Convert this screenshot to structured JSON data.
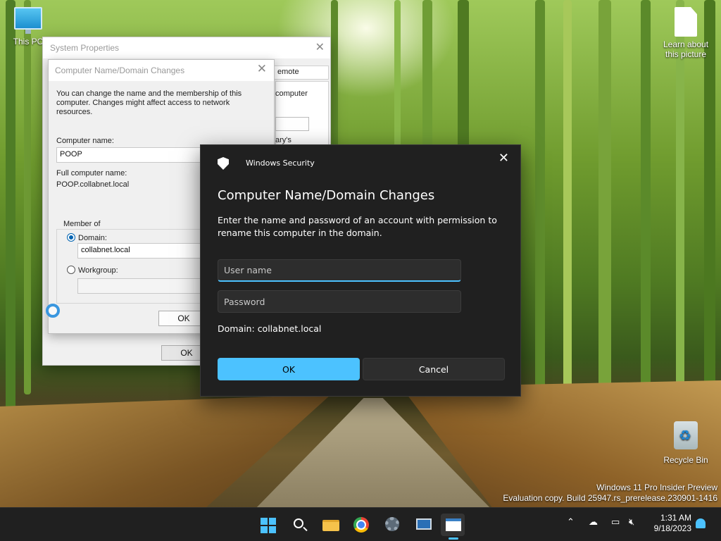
{
  "desktop": {
    "icons": [
      {
        "label": "This PC",
        "icon": "this-pc-icon"
      },
      {
        "label": "Learn about this picture",
        "icon": "document-icon"
      },
      {
        "label": "Recycle Bin",
        "icon": "recycle-bin-icon"
      }
    ],
    "watermark": {
      "line1": "Windows 11 Pro Insider Preview",
      "line2": "Evaluation copy. Build 25947.rs_prerelease.230901-1416"
    }
  },
  "system_properties": {
    "title": "System Properties",
    "tab_fragment": "emote",
    "text_fragment_1": "computer",
    "text_fragment_2": "ary's",
    "ok_label": "OK"
  },
  "name_changes": {
    "title": "Computer Name/Domain Changes",
    "description": "You can change the name and the membership of this computer. Changes might affect access to network resources.",
    "computer_name_label": "Computer name:",
    "computer_name_value": "POOP",
    "full_name_label": "Full computer name:",
    "full_name_value": "POOP.collabnet.local",
    "member_of_label": "Member of",
    "domain_label": "Domain:",
    "domain_value": "collabnet.local",
    "domain_selected": true,
    "workgroup_label": "Workgroup:",
    "workgroup_value": "",
    "ok_label": "OK"
  },
  "windows_security": {
    "app_title": "Windows Security",
    "heading": "Computer Name/Domain Changes",
    "message": "Enter the name and password of an account with permission to rename this computer in the domain.",
    "username_placeholder": "User name",
    "password_placeholder": "Password",
    "domain_text": "Domain: collabnet.local",
    "ok_label": "OK",
    "cancel_label": "Cancel",
    "accent": "#4cc2ff"
  },
  "taskbar": {
    "apps": [
      "start-icon",
      "search-icon",
      "file-explorer-icon",
      "chrome-icon",
      "settings-icon",
      "system-properties-icon",
      "windows-security-icon"
    ],
    "tray": [
      "chevron-up-icon",
      "network-icon",
      "display-icon",
      "volume-muted-icon",
      "notification-bell-icon"
    ],
    "time": "1:31 AM",
    "date": "9/18/2023"
  }
}
